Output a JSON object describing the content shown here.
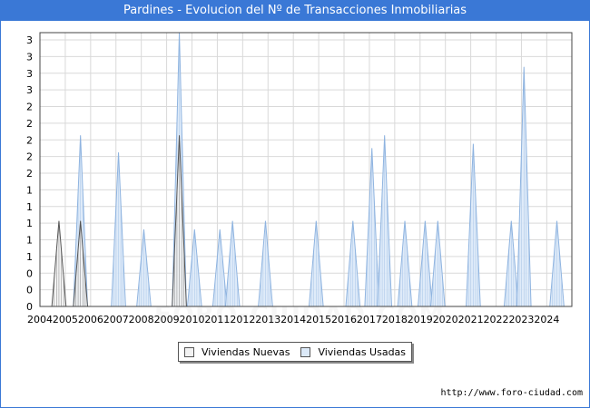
{
  "title": "Pardines - Evolucion del Nº de Transacciones Inmobiliarias",
  "source_url": "http://www.foro-ciudad.com",
  "watermark": "FORO-CIUDAD.COM",
  "colors": {
    "title_bar": "#3a78d6",
    "nuevas_fill": "#f2f2f2",
    "nuevas_stroke": "#555555",
    "usadas_fill": "#dbe9f8",
    "usadas_stroke": "#8fb4e0",
    "grid": "#d9d9d9"
  },
  "chart_data": {
    "type": "area",
    "title": "Pardines - Evolucion del Nº de Transacciones Inmobiliarias",
    "x_tick_labels": [
      "2004",
      "2005",
      "2006",
      "2007",
      "2008",
      "2009",
      "2010",
      "2011",
      "2012",
      "2013",
      "2014",
      "2015",
      "2016",
      "2017",
      "2018",
      "2019",
      "2020",
      "2021",
      "2022",
      "2023",
      "2024"
    ],
    "x_range": [
      2004,
      2024.99
    ],
    "y_tick_labels": [
      "0",
      "0",
      "0",
      "1",
      "1",
      "1",
      "1",
      "1",
      "2",
      "2",
      "2",
      "2",
      "2",
      "3",
      "3",
      "3",
      "3"
    ],
    "ylim": [
      0,
      3.2
    ],
    "grid": true,
    "legend_position": "bottom",
    "series": [
      {
        "name": "Viviendas Nuevas",
        "color": "#555555",
        "peaks": [
          {
            "x": 2004.75,
            "y": 1
          },
          {
            "x": 2005.6,
            "y": 1
          },
          {
            "x": 2009.5,
            "y": 2
          }
        ]
      },
      {
        "name": "Viviendas Usadas",
        "color": "#8fb4e0",
        "peaks": [
          {
            "x": 2005.6,
            "y": 2
          },
          {
            "x": 2007.1,
            "y": 1.8
          },
          {
            "x": 2008.1,
            "y": 0.9
          },
          {
            "x": 2009.5,
            "y": 3.2
          },
          {
            "x": 2010.1,
            "y": 0.9
          },
          {
            "x": 2011.1,
            "y": 0.9
          },
          {
            "x": 2011.6,
            "y": 1
          },
          {
            "x": 2012.9,
            "y": 1
          },
          {
            "x": 2014.9,
            "y": 1
          },
          {
            "x": 2016.35,
            "y": 1
          },
          {
            "x": 2017.1,
            "y": 1.85
          },
          {
            "x": 2017.6,
            "y": 2
          },
          {
            "x": 2018.4,
            "y": 1
          },
          {
            "x": 2019.2,
            "y": 1
          },
          {
            "x": 2019.7,
            "y": 1
          },
          {
            "x": 2021.1,
            "y": 1.9
          },
          {
            "x": 2022.6,
            "y": 1
          },
          {
            "x": 2023.1,
            "y": 2.8
          },
          {
            "x": 2024.4,
            "y": 1
          }
        ]
      }
    ]
  }
}
